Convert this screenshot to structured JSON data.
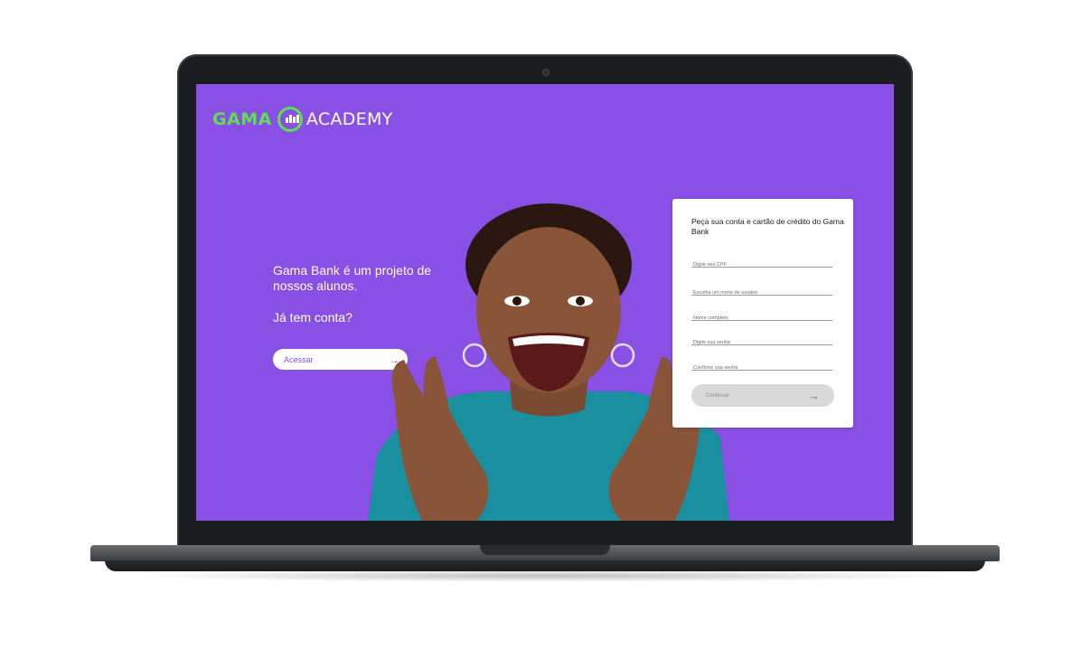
{
  "logo": {
    "left": "GAMA",
    "right": "ACADEMY",
    "accent_color": "#5ce04f"
  },
  "colors": {
    "screen_bg": "#8a4fe4",
    "accent": "#5ce04f"
  },
  "intro": {
    "line1": "Gama Bank é um projeto de nossos alunos.",
    "question": "Já tem conta?"
  },
  "access_button": {
    "label": "Acessar",
    "icon": "arrow-right-icon"
  },
  "form": {
    "title": "Peça sua conta e cartão de crédito do Gama Bank",
    "fields": [
      {
        "placeholder": "Digite seu CPF"
      },
      {
        "placeholder": "Escolha um nome de usuário"
      },
      {
        "placeholder": "Nome completo"
      },
      {
        "placeholder": "Digite sua senha"
      },
      {
        "placeholder": "Confirme sua senha"
      }
    ],
    "submit_label": "Continuar",
    "submit_icon": "arrow-right-icon"
  }
}
